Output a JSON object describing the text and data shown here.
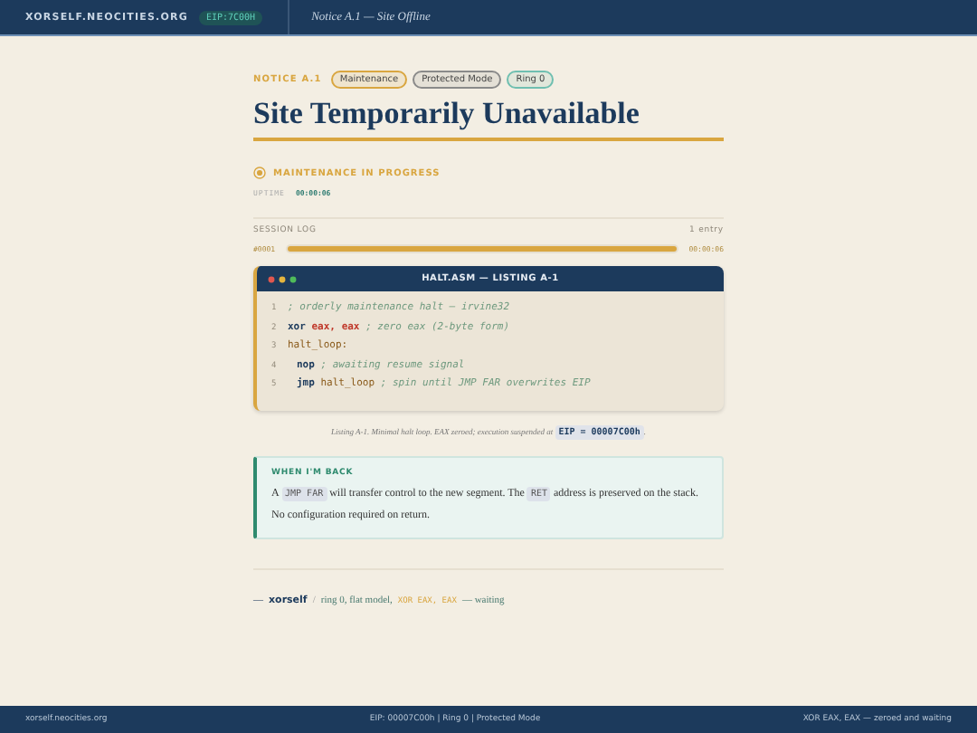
{
  "header": {
    "site": "XORSELF.NEOCITIES.ORG",
    "badge": "EIP:7C00H",
    "subtitle": "Notice A.1 — Site Offline"
  },
  "notice": {
    "label": "NOTICE A.1",
    "tags": [
      {
        "text": "Maintenance",
        "color": "#d9a640"
      },
      {
        "text": "Protected Mode",
        "color": "#8a8a8a"
      },
      {
        "text": "Ring 0",
        "color": "#6fbfb0"
      }
    ],
    "title": "Site Temporarily Unavailable"
  },
  "status": {
    "text": "MAINTENANCE IN PROGRESS",
    "uptime_label": "UPTIME",
    "uptime": "00:00:06"
  },
  "session_log": {
    "title": "SESSION LOG",
    "count": "1 entry",
    "entries": [
      {
        "id": "#0001",
        "level": 1,
        "time": "00:00:06"
      }
    ]
  },
  "listing": {
    "title": "HALT.ASM — LISTING A-1",
    "lines": [
      {
        "number": "1",
        "indent": false,
        "tokens": [
          {
            "kind": "comment",
            "text": "; orderly maintenance halt — irvine32"
          }
        ]
      },
      {
        "number": "2",
        "indent": false,
        "tokens": [
          {
            "kind": "keyword",
            "text": "xor"
          },
          {
            "kind": "register",
            "text": "eax,"
          },
          {
            "kind": "register",
            "text": "eax"
          },
          {
            "kind": "comment",
            "text": "; zero eax (2-byte form)"
          }
        ]
      },
      {
        "number": "3",
        "indent": false,
        "tokens": [
          {
            "kind": "label",
            "text": "halt_loop:"
          }
        ]
      },
      {
        "number": "4",
        "indent": true,
        "tokens": [
          {
            "kind": "keyword",
            "text": "nop"
          },
          {
            "kind": "comment",
            "text": "; awaiting resume signal"
          }
        ]
      },
      {
        "number": "5",
        "indent": true,
        "tokens": [
          {
            "kind": "keyword",
            "text": "jmp"
          },
          {
            "kind": "label",
            "text": "halt_loop"
          },
          {
            "kind": "comment",
            "text": "; spin until JMP FAR overwrites EIP"
          }
        ]
      }
    ],
    "caption": "Listing A-1.  Minimal halt loop. EAX zeroed; execution suspended at",
    "caption_code": "EIP = 00007C00h",
    "caption_end": "."
  },
  "callout": {
    "title": "WHEN I'M BACK",
    "parts": [
      {
        "kind": "text",
        "text": "A"
      },
      {
        "kind": "code",
        "text": "JMP FAR"
      },
      {
        "kind": "text",
        "text": "will transfer control to the new segment. The"
      },
      {
        "kind": "code",
        "text": "RET"
      },
      {
        "kind": "text",
        "text": "address is preserved on the stack. No configuration required on return."
      }
    ]
  },
  "signature": {
    "parts": [
      {
        "kind": "dash",
        "text": "—"
      },
      {
        "kind": "name",
        "text": "xorself"
      },
      {
        "kind": "slash",
        "text": "/"
      },
      {
        "kind": "text",
        "text": "ring 0, flat model,"
      },
      {
        "kind": "code",
        "text": "XOR EAX, EAX"
      },
      {
        "kind": "text",
        "text": "— waiting"
      }
    ]
  },
  "footer": {
    "left": "xorself.neocities.org",
    "center": "EIP: 00007C00h  |  Ring 0  |  Protected Mode",
    "right": "XOR EAX, EAX — zeroed and waiting"
  }
}
